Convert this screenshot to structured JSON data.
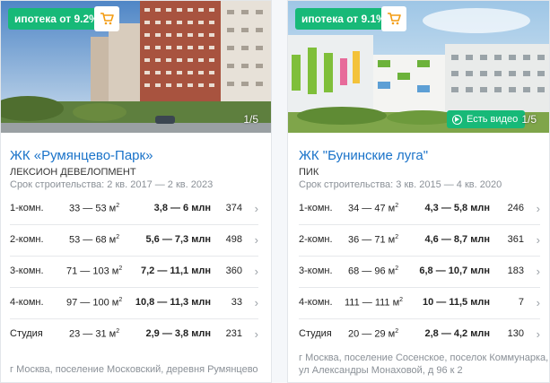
{
  "cards": [
    {
      "badge": "ипотека от 9.2%",
      "counter": "1/5",
      "title": "ЖК «Румянцево-Парк»",
      "developer": "ЛЕКСИОН ДЕВЕЛОПМЕНТ",
      "term": "Срок строительства: 2 кв. 2017 — 2 кв. 2023",
      "rows": [
        {
          "type": "1-комн.",
          "area": "33 — 53 м",
          "price": "3,8 — 6 млн",
          "count": "374"
        },
        {
          "type": "2-комн.",
          "area": "53 — 68 м",
          "price": "5,6 — 7,3 млн",
          "count": "498"
        },
        {
          "type": "3-комн.",
          "area": "71 — 103 м",
          "price": "7,2 — 11,1 млн",
          "count": "360"
        },
        {
          "type": "4-комн.",
          "area": "97 — 100 м",
          "price": "10,8 — 11,3 млн",
          "count": "33"
        },
        {
          "type": "Студия",
          "area": "23 — 31 м",
          "price": "2,9 — 3,8 млн",
          "count": "231"
        }
      ],
      "address": "г Москва, поселение Московский, деревня Румянцево"
    },
    {
      "badge": "ипотека от 9.1%",
      "counter": "1/5",
      "video": "Есть видео",
      "title": "ЖК \"Бунинские луга\"",
      "developer": "ПИК",
      "term": "Срок строительства: 3 кв. 2015 — 4 кв. 2020",
      "rows": [
        {
          "type": "1-комн.",
          "area": "34 — 47 м",
          "price": "4,3 — 5,8 млн",
          "count": "246"
        },
        {
          "type": "2-комн.",
          "area": "36 — 71 м",
          "price": "4,6 — 8,7 млн",
          "count": "361"
        },
        {
          "type": "3-комн.",
          "area": "68 — 96 м",
          "price": "6,8 — 10,7 млн",
          "count": "183"
        },
        {
          "type": "4-комн.",
          "area": "111 — 111 м",
          "price": "10 — 11,5 млн",
          "count": "7"
        },
        {
          "type": "Студия",
          "area": "20 — 29 м",
          "price": "2,8 — 4,2 млн",
          "count": "130"
        }
      ],
      "address": "г Москва, поселение Сосенское, поселок Коммунарка, ул Александры Монаховой, д 96 к 2"
    }
  ],
  "area_sup": "2",
  "colors": {
    "accent_green": "#17b978",
    "link_blue": "#1a73c9",
    "muted": "#8a9097"
  }
}
